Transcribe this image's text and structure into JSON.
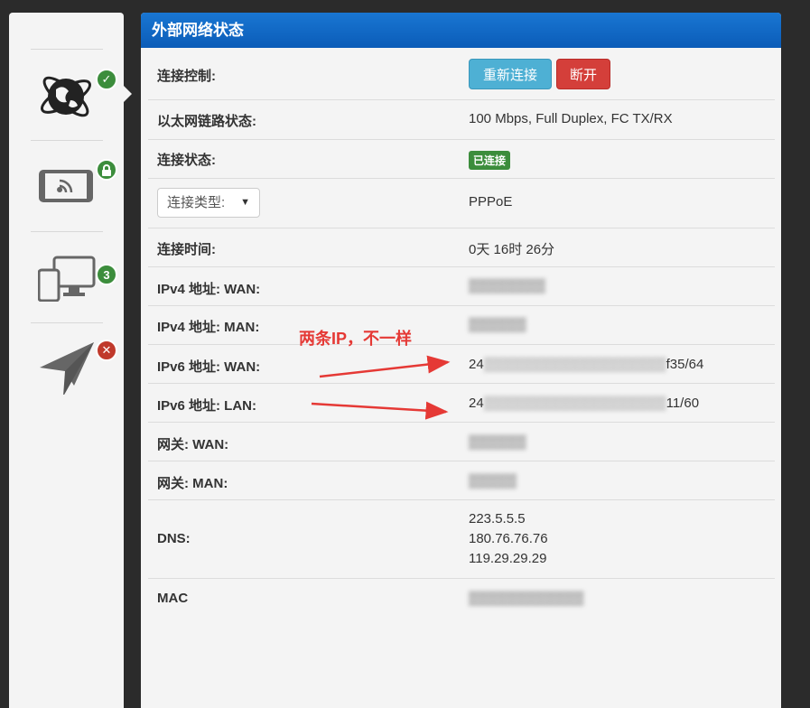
{
  "sidebar": {
    "items": [
      {
        "icon": "globe-network-icon",
        "badge_icon": "check-icon",
        "badge": "✓",
        "active": true
      },
      {
        "icon": "wireless-tablet-icon",
        "badge_icon": "lock-icon",
        "badge": ""
      },
      {
        "icon": "devices-icon",
        "badge_icon": "count-badge",
        "badge": "3"
      },
      {
        "icon": "paper-plane-icon",
        "badge_icon": "error-x-icon",
        "badge": "✕"
      }
    ]
  },
  "panel": {
    "title": "外部网络状态",
    "control": {
      "label": "连接控制:",
      "reconnect": "重新连接",
      "disconnect": "断开"
    },
    "ethernet": {
      "label": "以太网链路状态:",
      "value": "100 Mbps, Full Duplex, FC TX/RX"
    },
    "conn_status": {
      "label": "连接状态:",
      "value": "已连接"
    },
    "conn_type": {
      "select_value": "连接类型:",
      "value": "PPPoE"
    },
    "uptime": {
      "label": "连接时间:",
      "value": "0天 16时 26分"
    },
    "ipv4_wan": {
      "label": "IPv4 地址: WAN:",
      "value": "▒▒▒▒▒▒▒▒"
    },
    "ipv4_man": {
      "label": "IPv4 地址: MAN:",
      "value": "▒▒▒▒▒▒"
    },
    "ipv6_wan": {
      "label": "IPv6 地址: WAN:",
      "prefix": "24",
      "masked": "▒▒▒▒▒▒▒▒▒▒▒▒▒▒▒▒▒▒▒",
      "suffix": "f35/64"
    },
    "ipv6_lan": {
      "label": "IPv6 地址: LAN:",
      "prefix": "24",
      "masked": "▒▒▒▒▒▒▒▒▒▒▒▒▒▒▒▒▒▒▒",
      "suffix": "11/60"
    },
    "gw_wan": {
      "label": "网关: WAN:",
      "value": "▒▒▒▒▒▒"
    },
    "gw_man": {
      "label": "网关: MAN:",
      "value": "▒▒▒▒▒"
    },
    "dns": {
      "label": "DNS:",
      "servers": [
        "223.5.5.5",
        "180.76.76.76",
        "119.29.29.29"
      ]
    },
    "mac": {
      "label": "MAC",
      "value": "▒▒▒▒▒▒▒▒▒▒▒▒"
    }
  },
  "annotation": {
    "text": "两条IP，不一样",
    "color": "#e53935"
  }
}
